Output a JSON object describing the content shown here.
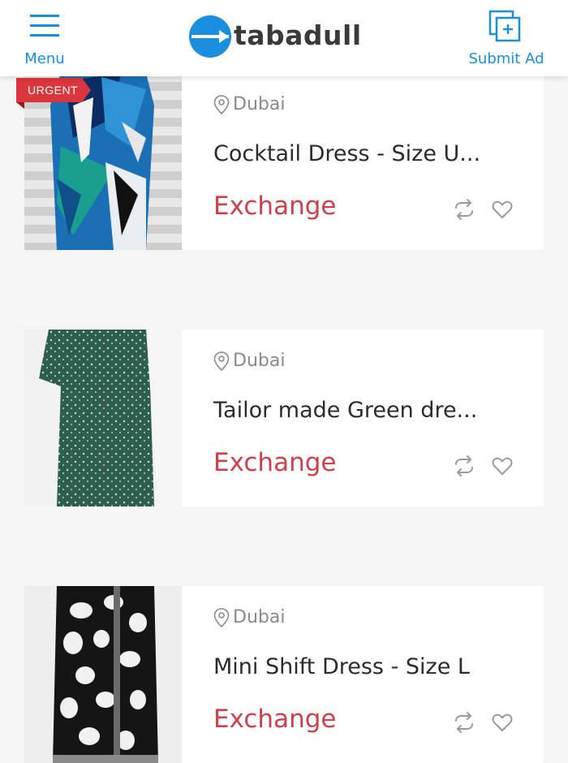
{
  "header": {
    "menu_label": "Menu",
    "logo_text": "tabadull",
    "submit_label": "Submit Ad",
    "accent_color": "#1a8fe0"
  },
  "listings": [
    {
      "badge": "URGENT",
      "location": "Dubai",
      "title": "Cocktail Dress - Size U...",
      "price": "Exchange"
    },
    {
      "location": "Dubai",
      "title": "Tailor made Green dre...",
      "price": "Exchange"
    },
    {
      "location": "Dubai",
      "title": "Mini Shift Dress - Size L",
      "price": "Exchange"
    }
  ],
  "icons": {
    "menu": "hamburger-icon",
    "submit": "add-ad-icon",
    "location": "map-pin-icon",
    "swap": "swap-icon",
    "favorite": "heart-icon"
  }
}
